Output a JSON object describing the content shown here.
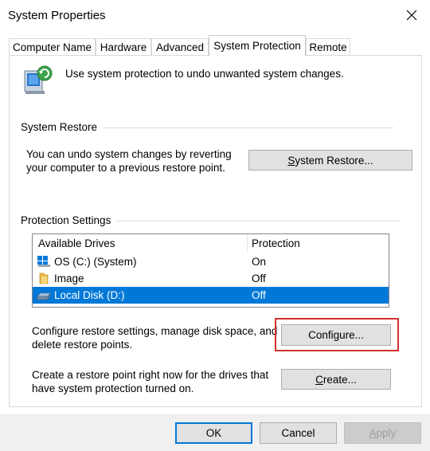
{
  "window": {
    "title": "System Properties",
    "close_icon": "close-icon"
  },
  "tabs": [
    {
      "label": "Computer Name",
      "active": false
    },
    {
      "label": "Hardware",
      "active": false
    },
    {
      "label": "Advanced",
      "active": false
    },
    {
      "label": "System Protection",
      "active": true
    },
    {
      "label": "Remote",
      "active": false
    }
  ],
  "intro": {
    "icon": "system-protection-icon",
    "text": "Use system protection to undo unwanted system changes."
  },
  "system_restore": {
    "group_title": "System Restore",
    "description_line1": "You can undo system changes by reverting",
    "description_line2": "your computer to a previous restore point.",
    "button_label_prefix": "",
    "button_label_underlined": "S",
    "button_label_rest": "ystem Restore..."
  },
  "protection_settings": {
    "group_title": "Protection Settings",
    "columns": [
      "Available Drives",
      "Protection"
    ],
    "drives": [
      {
        "name": "OS (C:) (System)",
        "protection": "On",
        "icon": "system-drive-icon",
        "selected": false
      },
      {
        "name": "Image",
        "protection": "Off",
        "icon": "folder-icon",
        "selected": false
      },
      {
        "name": "Local Disk (D:)",
        "protection": "Off",
        "icon": "disk-drive-icon",
        "selected": true
      }
    ],
    "configure_text_line1": "Configure restore settings, manage disk space, and",
    "configure_text_line2": "delete restore points.",
    "configure_button_prefix": "Confi",
    "configure_button_underlined": "g",
    "configure_button_rest": "ure...",
    "create_text_line1": "Create a restore point right now for the drives that",
    "create_text_line2": "have system protection turned on.",
    "create_button_prefix": "",
    "create_button_underlined": "C",
    "create_button_rest": "reate..."
  },
  "footer": {
    "ok_label": "OK",
    "cancel_label": "Cancel",
    "apply_prefix": "",
    "apply_underlined": "A",
    "apply_rest": "pply"
  },
  "colors": {
    "selection": "#0078d7",
    "highlight_box": "#d32f2f",
    "default_button_border": "#0078d7"
  }
}
